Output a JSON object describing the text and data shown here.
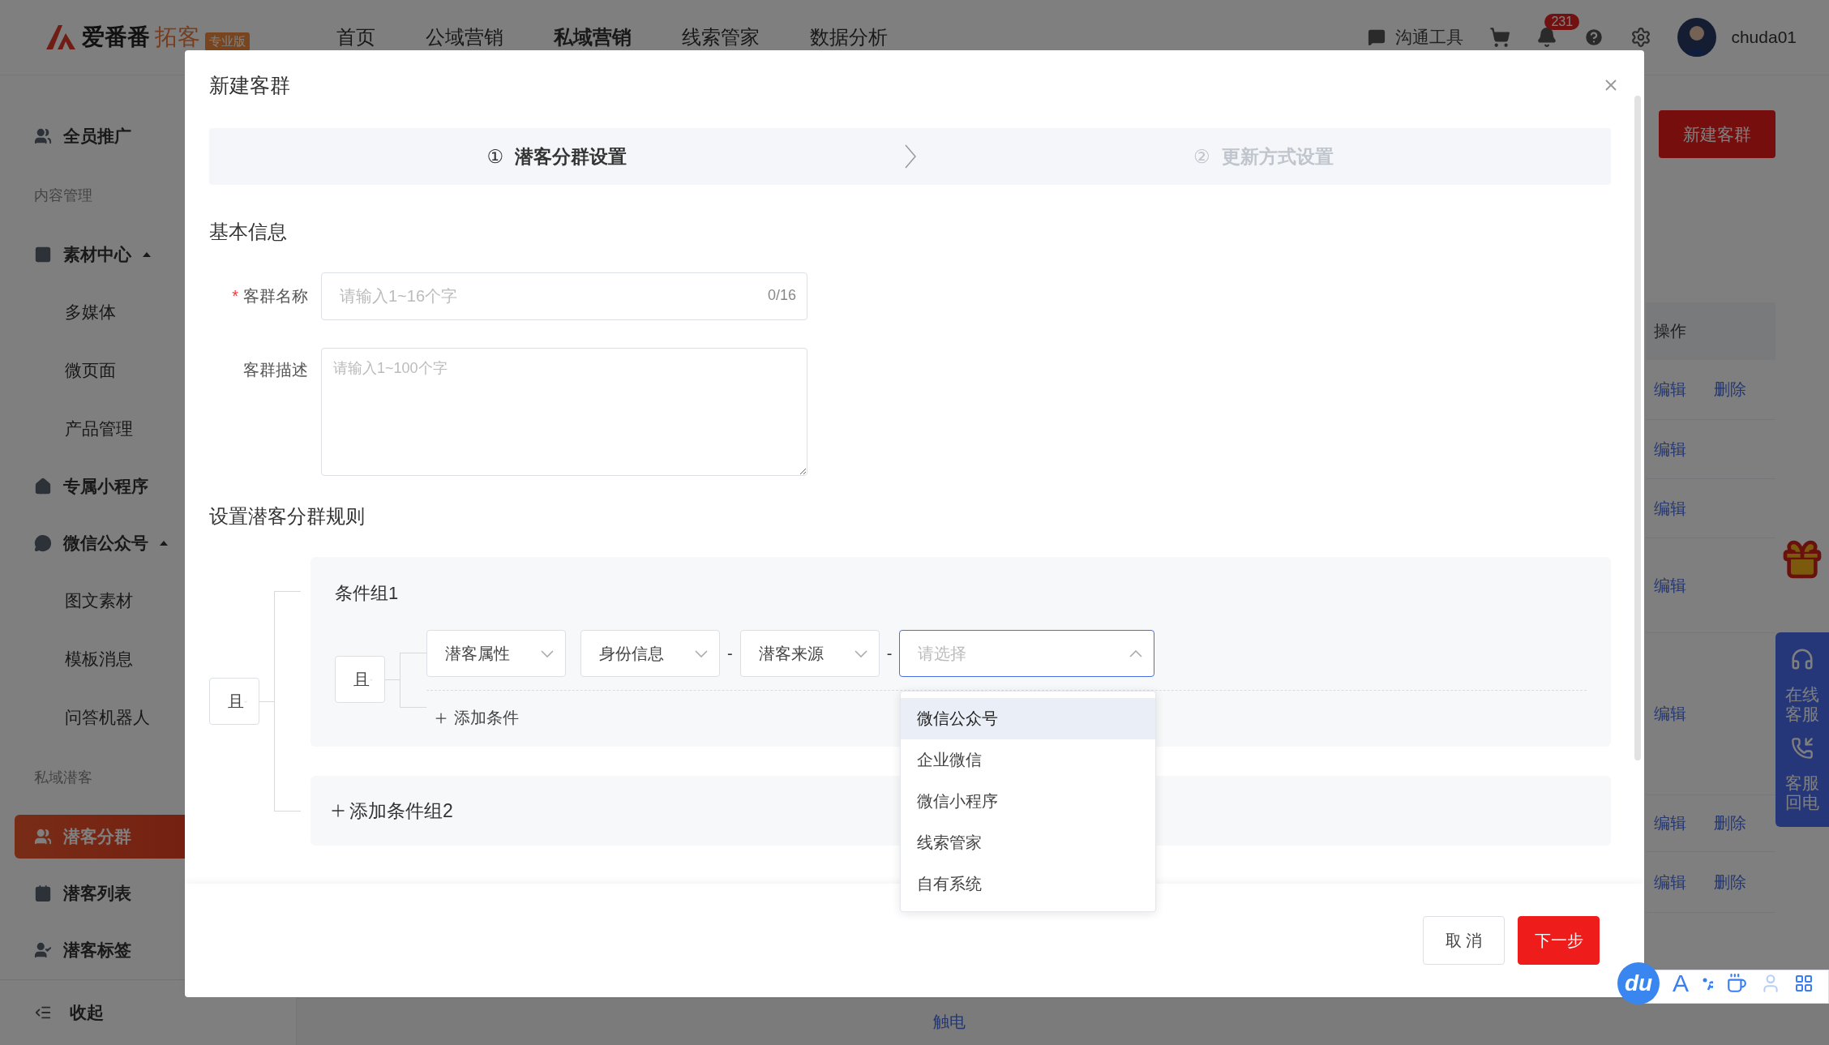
{
  "topbar": {
    "logo": {
      "name": "爱番番",
      "product": "拓客",
      "edition": "专业版"
    },
    "nav": [
      {
        "label": "首页",
        "selected": false
      },
      {
        "label": "公域营销",
        "selected": false
      },
      {
        "label": "私域营销",
        "selected": true
      },
      {
        "label": "线索管家",
        "selected": false
      },
      {
        "label": "数据分析",
        "selected": false
      }
    ],
    "chat_tool": "沟通工具",
    "notification_count": "231",
    "user": "chuda01"
  },
  "sidebar": {
    "items": [
      {
        "kind": "link",
        "label": "全员推广",
        "selected": false
      },
      {
        "kind": "heading",
        "label": "内容管理"
      },
      {
        "kind": "link",
        "label": "素材中心",
        "selected": false,
        "expanded": true,
        "children": [
          {
            "label": "多媒体",
            "selected": false
          },
          {
            "label": "微页面",
            "selected": false
          },
          {
            "label": "产品管理",
            "selected": false
          }
        ]
      },
      {
        "kind": "link",
        "label": "专属小程序",
        "selected": false
      },
      {
        "kind": "link",
        "label": "微信公众号",
        "selected": false,
        "expanded": true,
        "children": [
          {
            "label": "图文素材",
            "selected": false
          },
          {
            "label": "模板消息",
            "selected": false
          },
          {
            "label": "问答机器人",
            "selected": false
          }
        ]
      },
      {
        "kind": "heading",
        "label": "私域潜客"
      },
      {
        "kind": "link",
        "label": "潜客分群",
        "selected": true
      },
      {
        "kind": "link",
        "label": "潜客列表",
        "selected": false
      },
      {
        "kind": "link",
        "label": "潜客标签",
        "selected": false
      }
    ],
    "collapse": "收起"
  },
  "page": {
    "primary_button": "新建客群",
    "table": {
      "columns": [
        "操作"
      ],
      "rows": [
        {
          "actions": [
            "编辑",
            "删除"
          ]
        },
        {
          "actions": [
            "编辑"
          ]
        },
        {
          "actions": [
            "编辑"
          ]
        },
        {
          "actions": [
            "编辑"
          ]
        },
        {
          "actions": [
            "编辑"
          ]
        },
        {
          "actions": [
            "编辑",
            "删除"
          ]
        },
        {
          "actions": [
            "编辑",
            "删除"
          ]
        }
      ],
      "footer_cell": "触电"
    }
  },
  "service_panel": [
    "在线客服",
    "客服回电"
  ],
  "modal": {
    "title": "新建客群",
    "steps": [
      {
        "number": "①",
        "label": "潜客分群设置",
        "selected": true
      },
      {
        "number": "②",
        "label": "更新方式设置",
        "selected": false
      }
    ],
    "basic_info": {
      "title": "基本信息",
      "fields": [
        {
          "kind": "input",
          "label": "客群名称",
          "required": true,
          "required_mark": "*",
          "placeholder": "请输入1~16个字",
          "counter": "0/16"
        },
        {
          "kind": "textarea",
          "label": "客群描述",
          "placeholder": "请输入1~100个字"
        }
      ]
    },
    "rules": {
      "title": "设置潜客分群规则",
      "logic": "且",
      "groups": [
        {
          "title": "条件组1",
          "logic": "且",
          "selects": [
            {
              "value": "潜客属性",
              "open": false
            },
            {
              "value": "身份信息",
              "open": false
            },
            {
              "separator": "-",
              "value": "潜客来源",
              "open": false
            },
            {
              "separator": "-",
              "placeholder": "请选择",
              "open": true,
              "options": [
                {
                  "label": "微信公众号",
                  "highlighted": true
                },
                {
                  "label": "企业微信",
                  "highlighted": false
                },
                {
                  "label": "微信小程序",
                  "highlighted": false
                },
                {
                  "label": "线索管家",
                  "highlighted": false
                },
                {
                  "label": "自有系统",
                  "highlighted": false
                }
              ]
            }
          ],
          "add_condition": "添加条件"
        }
      ],
      "add_group": "添加条件组2"
    },
    "buttons": [
      {
        "kind": "secondary",
        "label": "取 消"
      },
      {
        "kind": "primary",
        "label": "下一步"
      }
    ]
  },
  "input_toolbar": {
    "logo": "du",
    "letter": "A"
  }
}
